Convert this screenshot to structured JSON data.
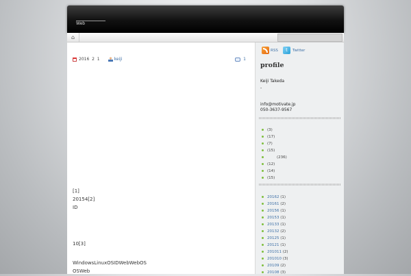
{
  "header": {
    "description": "Web"
  },
  "nav": {
    "home_icon": "home-icon",
    "search_placeholder": ""
  },
  "post": {
    "date": "2016  2  1",
    "author": "keiji",
    "comment_count": "1",
    "lines": [
      "[1]",
      "20154[2]",
      "ID",
      "10[3]",
      "WindowsLinuxOSIDWebWebOS",
      "OSWeb"
    ]
  },
  "sidebar": {
    "rss_label": "RSS",
    "twitter_label": "Twitter",
    "profile_title": "profile",
    "name": "Keiji Takeda",
    "dash": "-",
    "email": "info@motivate.jp",
    "phone": "050-3637-9567",
    "categories": [
      {
        "label": "",
        "count": "(3)"
      },
      {
        "label": "",
        "count": "(17)"
      },
      {
        "label": "",
        "count": "(7)"
      },
      {
        "label": "",
        "count": "(15)"
      },
      {
        "label": "",
        "count": "(236)"
      },
      {
        "label": "",
        "count": "(12)"
      },
      {
        "label": "",
        "count": "(14)"
      },
      {
        "label": "",
        "count": "(15)"
      }
    ],
    "archives": [
      {
        "label": "20162",
        "count": "(1)"
      },
      {
        "label": "20161",
        "count": "(2)"
      },
      {
        "label": "20156",
        "count": "(1)"
      },
      {
        "label": "20153",
        "count": "(1)"
      },
      {
        "label": "20133",
        "count": "(1)"
      },
      {
        "label": "20132",
        "count": "(2)"
      },
      {
        "label": "20125",
        "count": "(1)"
      },
      {
        "label": "20121",
        "count": "(1)"
      },
      {
        "label": "201011",
        "count": "(2)"
      },
      {
        "label": "201010",
        "count": "(3)"
      },
      {
        "label": "20109",
        "count": "(2)"
      },
      {
        "label": "20108",
        "count": "(3)"
      }
    ],
    "colors": {
      "accent_link": "#3b6ea5",
      "bullet": "#7fbf3f"
    }
  }
}
